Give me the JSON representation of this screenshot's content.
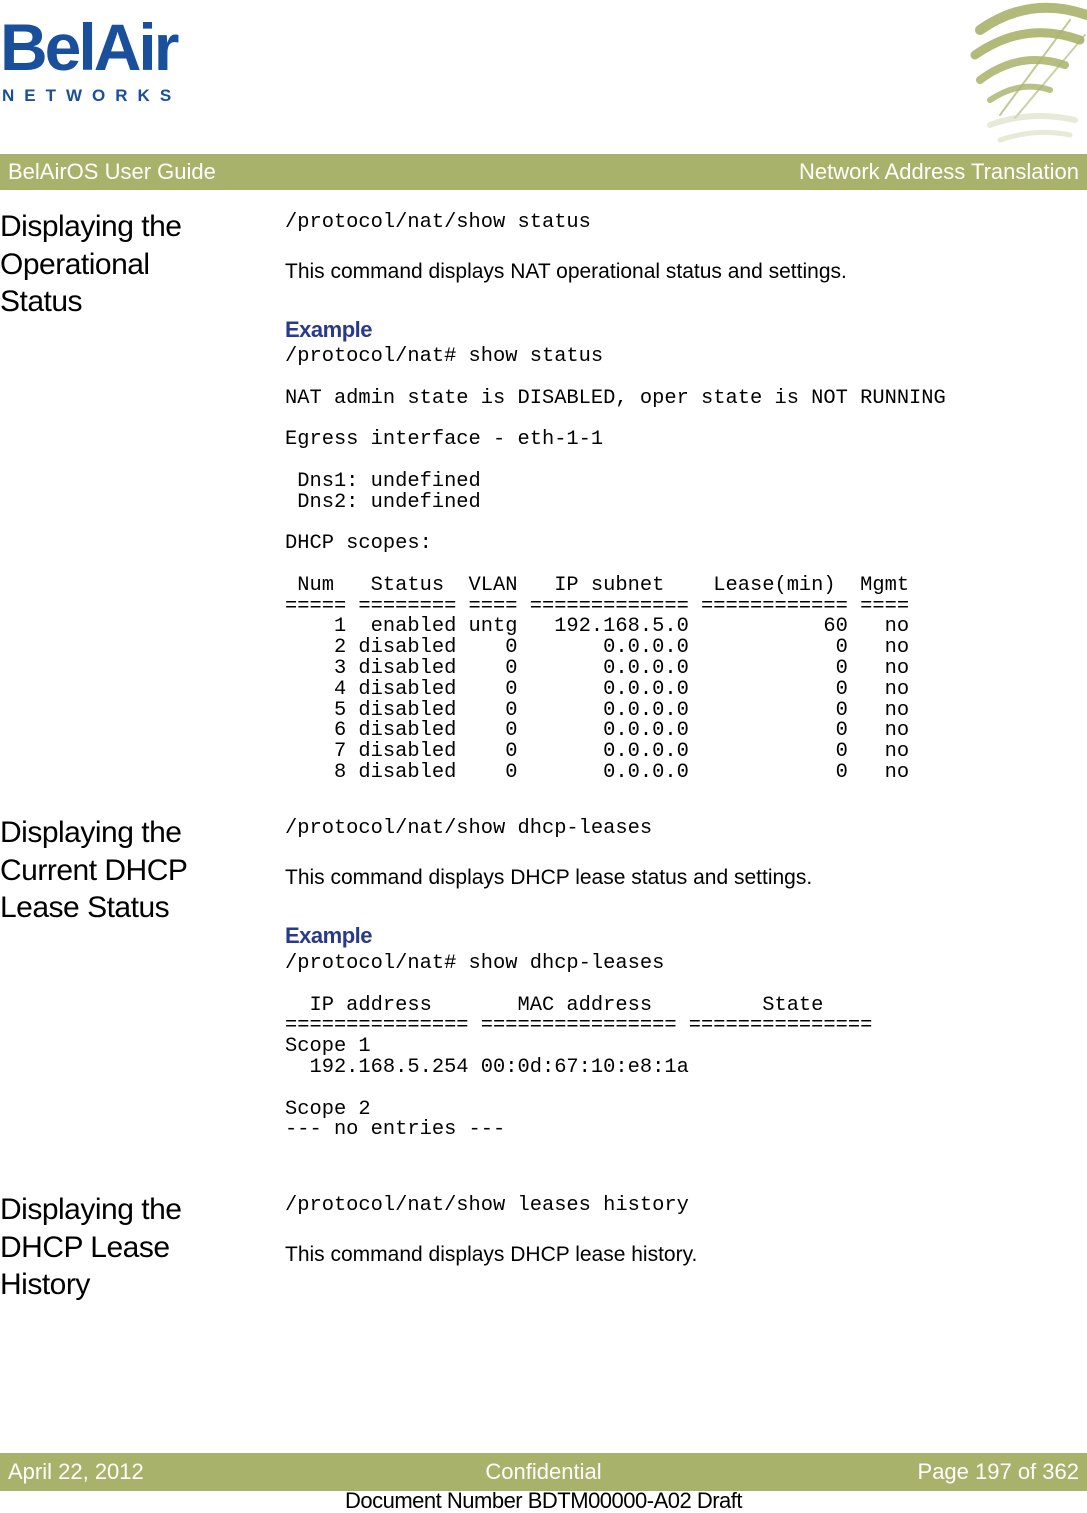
{
  "brand": {
    "logo_name": "BelAir",
    "logo_sub": "NETWORKS",
    "emblem_icon": "belair-arc-emblem-icon",
    "accent_color": "#a9b26a",
    "logo_color": "#1a4f9c",
    "example_color": "#2a3a8a"
  },
  "header": {
    "left": "BelAirOS User Guide",
    "right": "Network Address Translation"
  },
  "sections": [
    {
      "title_lines": [
        "Displaying the",
        "Operational",
        "Status"
      ],
      "command": "/protocol/nat/show status",
      "description": "This command displays NAT operational status and settings.",
      "example_label": "Example",
      "example_output": "/protocol/nat# show status\n\nNAT admin state is DISABLED, oper state is NOT RUNNING\n\nEgress interface - eth-1-1\n\n Dns1: undefined\n Dns2: undefined\n\nDHCP scopes:\n\n Num   Status  VLAN   IP subnet    Lease(min)  Mgmt\n===== ======== ==== ============= ============ ====\n    1  enabled untg   192.168.5.0           60   no\n    2 disabled    0       0.0.0.0            0   no\n    3 disabled    0       0.0.0.0            0   no\n    4 disabled    0       0.0.0.0            0   no\n    5 disabled    0       0.0.0.0            0   no\n    6 disabled    0       0.0.0.0            0   no\n    7 disabled    0       0.0.0.0            0   no\n    8 disabled    0       0.0.0.0            0   no"
    },
    {
      "title_lines": [
        "Displaying the",
        "Current DHCP",
        "Lease Status"
      ],
      "command": "/protocol/nat/show dhcp-leases",
      "description": "This command displays DHCP lease status and settings.",
      "example_label": "Example",
      "example_output": "/protocol/nat# show dhcp-leases\n\n  IP address       MAC address         State\n=============== ================ ===============\nScope 1\n  192.168.5.254 00:0d:67:10:e8:1a\n\nScope 2\n--- no entries ---"
    },
    {
      "title_lines": [
        "Displaying the",
        "DHCP Lease",
        "History"
      ],
      "command": "/protocol/nat/show leases history",
      "description": "This command displays DHCP lease history."
    }
  ],
  "footer": {
    "date": "April 22, 2012",
    "classification": "Confidential",
    "page": "Page 197 of 362",
    "doc_number": "Document Number BDTM00000-A02 Draft"
  }
}
